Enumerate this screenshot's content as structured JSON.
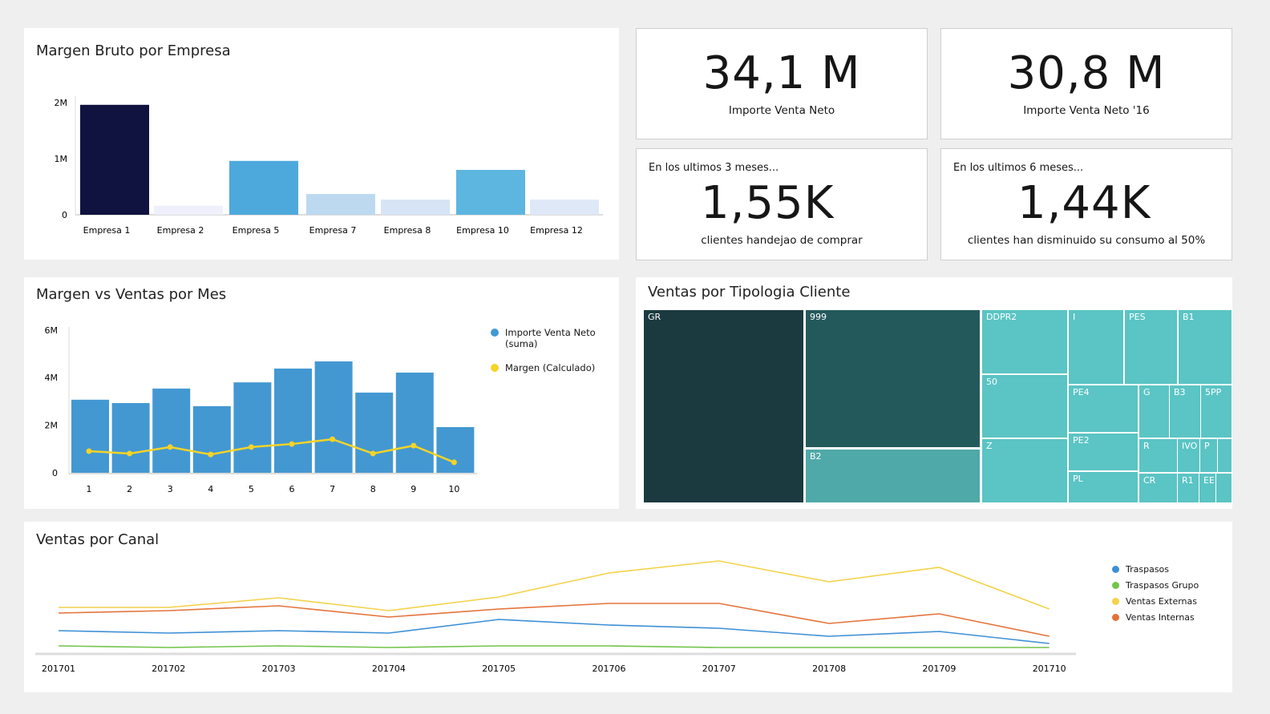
{
  "panels": {
    "margen_empresa": "Margen Bruto por Empresa",
    "margen_ventas": "Margen vs Ventas por Mes",
    "tipologia": "Ventas por Tipologia Cliente",
    "canal": "Ventas por Canal"
  },
  "kpis": [
    {
      "value": "34,1 M",
      "label": "Importe Venta Neto",
      "sub": ""
    },
    {
      "value": "30,8 M",
      "label": "Importe Venta Neto '16",
      "sub": ""
    },
    {
      "value": "1,55K",
      "label": "clientes handejao de comprar",
      "sub": "En los ultimos 3 meses..."
    },
    {
      "value": "1,44K",
      "label": "clientes han disminuido su consumo al 50%",
      "sub": "En los ultimos 6 meses..."
    }
  ],
  "chart_data": [
    {
      "type": "bar",
      "title": "Margen Bruto por Empresa",
      "categories": [
        "Empresa 1",
        "Empresa 2",
        "Empresa 5",
        "Empresa 7",
        "Empresa 8",
        "Empresa 10",
        "Empresa 12"
      ],
      "values": [
        1.96,
        0.16,
        0.96,
        0.37,
        0.27,
        0.8,
        0.27
      ],
      "colors": [
        "#10133f",
        "#eef0fb",
        "#4da9dc",
        "#bcd9f0",
        "#d6e4f6",
        "#5db6e0",
        "#dee8f7"
      ],
      "unit": "M",
      "ylim": [
        0,
        2
      ],
      "yticks": [
        "0",
        "1M",
        "2M"
      ],
      "grid": false
    },
    {
      "type": "bar+line",
      "title": "Margen vs Ventas por Mes",
      "categories": [
        "1",
        "2",
        "3",
        "4",
        "5",
        "6",
        "7",
        "8",
        "9",
        "10"
      ],
      "series": [
        {
          "name": "Importe Venta Neto (suma)",
          "name_lines": [
            "Importe Venta Neto",
            "(suma)"
          ],
          "type": "bar",
          "color": "#4398d2",
          "values": [
            3.07,
            2.93,
            3.54,
            2.8,
            3.8,
            4.38,
            4.68,
            3.37,
            4.21,
            1.92
          ]
        },
        {
          "name": "Margen (Calculado)",
          "type": "line",
          "color": "#f5d327",
          "values": [
            0.91,
            0.81,
            1.08,
            0.77,
            1.08,
            1.21,
            1.41,
            0.81,
            1.14,
            0.44
          ]
        }
      ],
      "ylim": [
        0,
        6
      ],
      "yticks": [
        "0",
        "2M",
        "4M",
        "6M"
      ],
      "legend": "right"
    },
    {
      "type": "treemap",
      "title": "Ventas por Tipologia Cliente",
      "labels": [
        "GR",
        "999",
        "B2",
        "DDPR2",
        "50",
        "Z",
        "I",
        "PES",
        "B1",
        "PE4",
        "PE2",
        "PL",
        "G",
        "B3",
        "5PP",
        "R",
        "IVO",
        "P",
        "",
        "CR",
        "R1",
        "EE",
        ""
      ],
      "colors": {
        "dark": "#1b3a3f",
        "mid": "#24595c",
        "b2": "#4fa9a8",
        "light": "#5bc4c4"
      }
    },
    {
      "type": "line",
      "title": "Ventas por Canal",
      "categories": [
        "201701",
        "201702",
        "201703",
        "201704",
        "201705",
        "201706",
        "201707",
        "201708",
        "201709",
        "201710"
      ],
      "series": [
        {
          "name": "Traspasos",
          "color": "#3d8fd6",
          "values": [
            28,
            25,
            28,
            25,
            42,
            35,
            31,
            21,
            27,
            12
          ]
        },
        {
          "name": "Traspasos Grupo",
          "color": "#72c44b",
          "values": [
            9,
            7,
            9,
            7,
            9,
            9,
            7,
            7,
            7,
            7
          ]
        },
        {
          "name": "Ventas Externas",
          "color": "#f4d24a",
          "values": [
            57,
            57,
            69,
            53,
            70,
            100,
            115,
            89,
            107,
            55
          ]
        },
        {
          "name": "Ventas Internas",
          "color": "#e4733a",
          "values": [
            50,
            53,
            59,
            45,
            55,
            62,
            62,
            37,
            49,
            21
          ]
        }
      ],
      "legend": "right",
      "yaxis_visible": false
    }
  ]
}
